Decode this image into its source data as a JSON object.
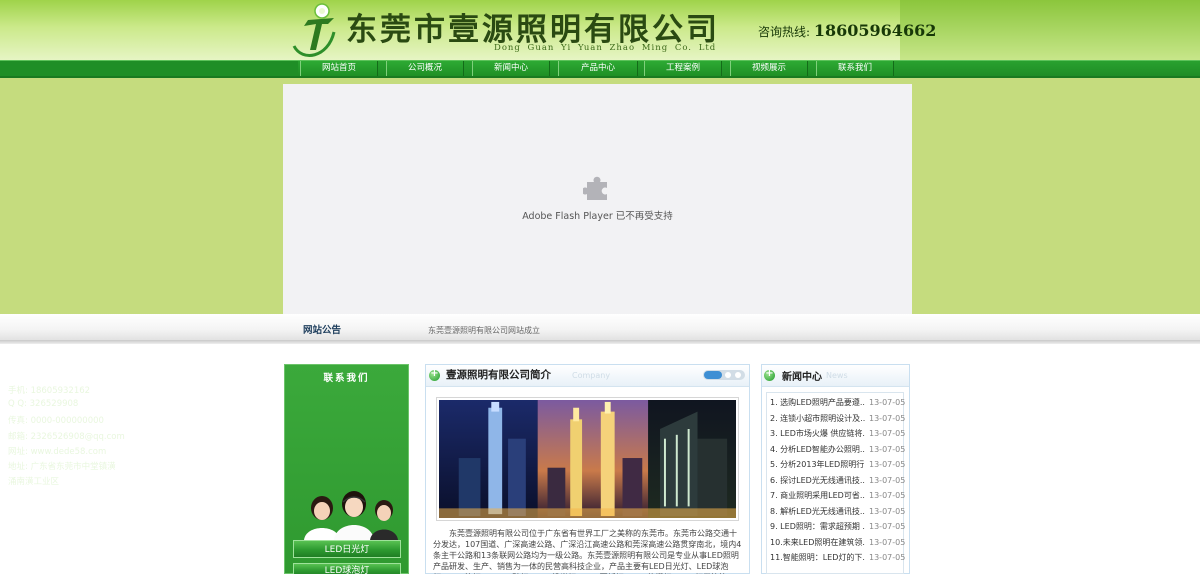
{
  "header": {
    "company_name": "东莞市壹源照明有限公司",
    "company_name_en": "Dong Guan Yi Yuan Zhao Ming Co. Ltd",
    "hotline_label": "咨询热线:",
    "hotline_number": "18605964662"
  },
  "nav": {
    "items": [
      "网站首页",
      "公司概况",
      "新闻中心",
      "产品中心",
      "工程案例",
      "视频展示",
      "联系我们"
    ]
  },
  "flash": {
    "message": "Adobe Flash Player 已不再受支持"
  },
  "notice": {
    "title": "网站公告",
    "text": "东莞壹源照明有限公司网站成立"
  },
  "contact": {
    "title": "联系我们",
    "rows": [
      "手机: 18605932162",
      "Q Q: 326529908",
      "传真: 0000-000000000",
      "邮箱: 2326526908@qq.com",
      "网址: www.dede58.com",
      "地址: 广东省东莞市中堂镇潢"
    ],
    "address_line2": "涌南潢工业区",
    "buttons": [
      "LED日光灯",
      "LED球泡灯"
    ]
  },
  "intro": {
    "title": "壹源照明有限公司简介",
    "subtitle": "Company",
    "text": "东莞壹源照明有限公司位于广东省有世界工厂之美称的东莞市。东莞市公路交通十分发达，107国道、广深高速公路、广深沿江高速公路和莞深高速公路贯穿南北，境内4条主干公路和13条联网公路均为一级公路。东莞壹源照明有限公司是专业从事LED照明产品研发、生产、销售为一体的民营高科技企业，产品主要有LED日光灯、LED球泡灯、LED筒灯、LED工矿灯、LED投光灯、LED面板灯、LED格栅灯、LED灯带等等，公司追求高效节能"
  },
  "news": {
    "title": "新闻中心",
    "subtitle": "News",
    "items": [
      {
        "title": "1. 选购LED照明产品要遵...",
        "date": "13-07-05"
      },
      {
        "title": "2. 连锁小超市照明设计及...",
        "date": "13-07-05"
      },
      {
        "title": "3. LED市场火爆 供应链将...",
        "date": "13-07-05"
      },
      {
        "title": "4. 分析LED智能办公照明...",
        "date": "13-07-05"
      },
      {
        "title": "5. 分析2013年LED照明行...",
        "date": "13-07-05"
      },
      {
        "title": "6. 探讨LED光无线通讯技...",
        "date": "13-07-05"
      },
      {
        "title": "7. 商业照明采用LED可省...",
        "date": "13-07-05"
      },
      {
        "title": "8. 解析LED光无线通讯技...",
        "date": "13-07-05"
      },
      {
        "title": "9. LED照明：需求超预期 ...",
        "date": "13-07-05"
      },
      {
        "title": "10.未来LED照明在建筑领...",
        "date": "13-07-05"
      },
      {
        "title": "11.智能照明：LED灯的下...",
        "date": "13-07-05"
      }
    ]
  },
  "colors": {
    "header_green": "#9fd34a",
    "nav_green": "#1f8f25",
    "flash_band": "#c5dc7e",
    "contact_green": "#2f9930"
  }
}
